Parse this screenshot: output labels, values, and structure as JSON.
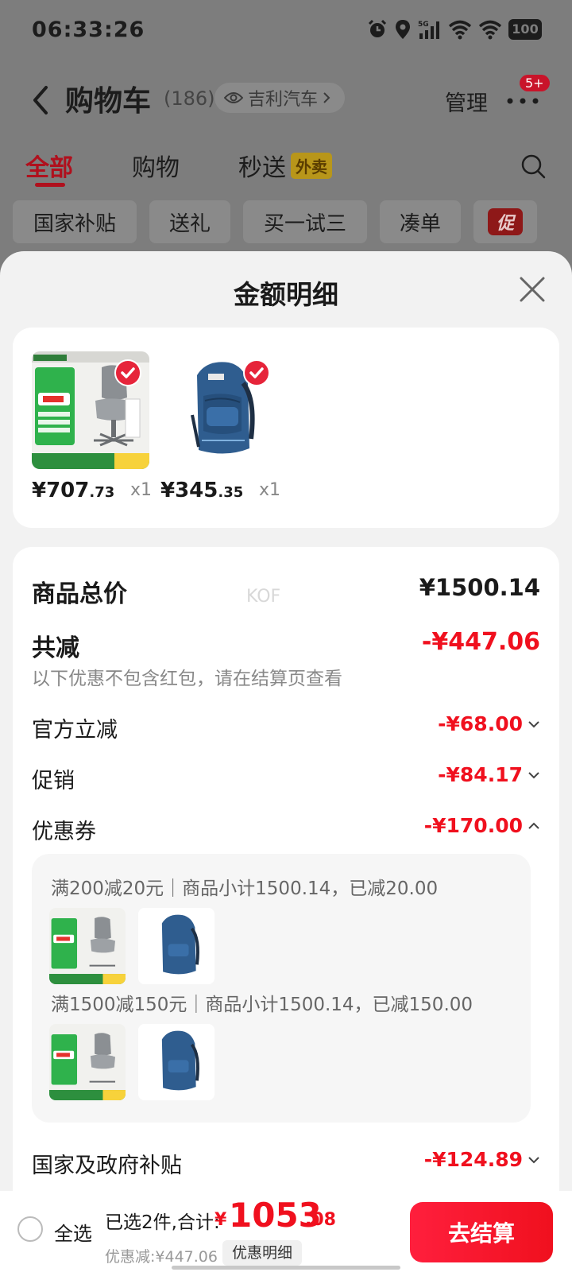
{
  "status_bar": {
    "time": "06:33:26",
    "network": "5G",
    "battery": "100"
  },
  "nav": {
    "title": "购物车",
    "count": "(186)",
    "store_chip": "吉利汽车",
    "manage": "管理",
    "more_badge": "5+"
  },
  "tabs": [
    {
      "label": "全部",
      "active": true
    },
    {
      "label": "购物",
      "active": false
    },
    {
      "label": "秒送",
      "active": false,
      "badge": "外卖"
    }
  ],
  "chips": [
    "国家补贴",
    "送礼",
    "买一试三",
    "凑单"
  ],
  "promo_chip_icon": "促",
  "sheet": {
    "title": "金额明细",
    "items": [
      {
        "price_int": "¥707",
        "price_dec": ".73",
        "qty": "x1",
        "product": "chair",
        "checked": true
      },
      {
        "price_int": "¥345",
        "price_dec": ".35",
        "qty": "x1",
        "product": "backpack",
        "checked": true
      }
    ],
    "watermark": "KOF",
    "goods_total_label": "商品总价",
    "goods_total_value": "¥1500.14",
    "total_discount_label": "共减",
    "total_discount_value": "-¥447.06",
    "total_discount_note": "以下优惠不包含红包，请在结算页查看",
    "official_label": "官方立减",
    "official_value": "-¥68.00",
    "promo_label": "促销",
    "promo_value": "-¥84.17",
    "coupon_label": "优惠券",
    "coupon_value": "-¥170.00",
    "coupons": [
      {
        "text": "满200减20元｜商品小计1500.14，已减20.00"
      },
      {
        "text": "满1500减150元｜商品小计1500.14，已减150.00"
      }
    ],
    "subsidy_label": "国家及政府补贴",
    "subsidy_value": "-¥124.89"
  },
  "bottom_bar": {
    "select_all": "全选",
    "summary": "已选2件,合计:",
    "currency": "¥",
    "total_int": "1053",
    "total_dec": ".08",
    "discount": "优惠减:¥447.06",
    "detail_button": "优惠明细",
    "checkout": "去结算"
  },
  "colors": {
    "accent_red": "#f0101e",
    "overlay_gray": "#7d7d7d",
    "sheet_bg": "#f2f2f2"
  }
}
